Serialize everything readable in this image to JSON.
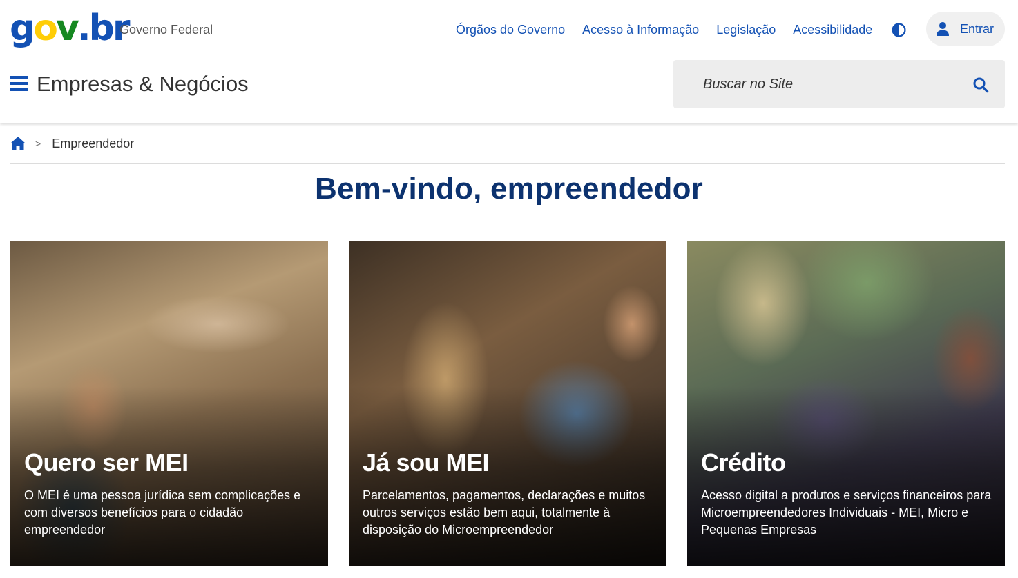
{
  "header": {
    "logo": {
      "g": "g",
      "o": "o",
      "v": "v",
      "dot": ".",
      "b": "b",
      "r": "r"
    },
    "subtitle": "Governo Federal",
    "links": [
      "Órgãos do Governo",
      "Acesso à Informação",
      "Legislação",
      "Acessibilidade"
    ],
    "contrast_icon": "contrast-icon",
    "login_label": "Entrar",
    "site_title": "Empresas & Negócios",
    "search_placeholder": "Buscar no Site"
  },
  "breadcrumb": {
    "home_icon": "home-icon",
    "separator": ">",
    "current": "Empreendedor"
  },
  "main": {
    "title": "Bem-vindo, empreendedor",
    "cards": [
      {
        "title": "Quero ser MEI",
        "description": "O MEI é uma pessoa jurídica sem complicações e com diversos benefícios para o cidadão empreendedor"
      },
      {
        "title": "Já sou MEI",
        "description": "Parcelamentos, pagamentos, declarações e muitos outros serviços estão bem aqui, totalmente à disposição do Microempreendedor"
      },
      {
        "title": "Crédito",
        "description": "Acesso digital a produtos e serviços financeiros para Microempreendedores Individuais - MEI, Micro e Pequenas Empresas"
      }
    ]
  },
  "colors": {
    "primary_blue": "#1351b4",
    "title_blue": "#0c326f",
    "gov_yellow": "#ffcd07",
    "gov_green": "#168821"
  }
}
